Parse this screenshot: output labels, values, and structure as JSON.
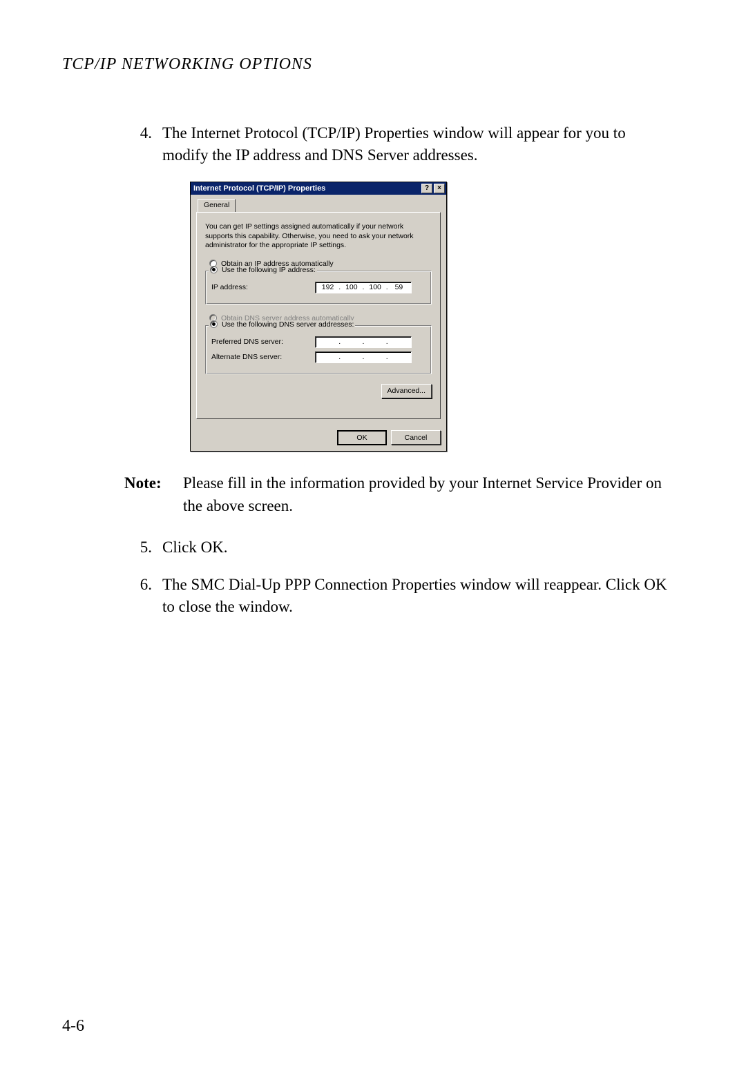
{
  "header": "TCP/IP NETWORKING OPTIONS",
  "page_number": "4-6",
  "steps": {
    "s4_num": "4.",
    "s4_text": "The Internet Protocol (TCP/IP) Properties window will appear for you to modify the IP address and DNS Server addresses.",
    "s5_num": "5.",
    "s5_text": "Click OK.",
    "s6_num": "6.",
    "s6_text": "The SMC Dial-Up PPP Connection Properties window will reappear. Click OK to close the window."
  },
  "note": {
    "label": "Note:",
    "text": "Please fill in the information provided by your Internet Service Provider on the above screen."
  },
  "dialog": {
    "title": "Internet Protocol (TCP/IP) Properties",
    "help_glyph": "?",
    "close_glyph": "×",
    "tab_general": "General",
    "description": "You can get IP settings assigned automatically if your network supports this capability. Otherwise, you need to ask your network administrator for the appropriate IP settings.",
    "radio_obtain_ip": "Obtain an IP address automatically",
    "radio_use_ip": "Use the following IP address:",
    "ip_label": "IP address:",
    "ip_octets": {
      "a": "192",
      "b": "100",
      "c": "100",
      "d": "59"
    },
    "radio_obtain_dns": "Obtain DNS server address automatically",
    "radio_use_dns": "Use the following DNS server addresses:",
    "pref_dns_label": "Preferred DNS server:",
    "alt_dns_label": "Alternate DNS server:",
    "advanced_btn": "Advanced...",
    "ok_btn": "OK",
    "cancel_btn": "Cancel",
    "dot": "."
  }
}
